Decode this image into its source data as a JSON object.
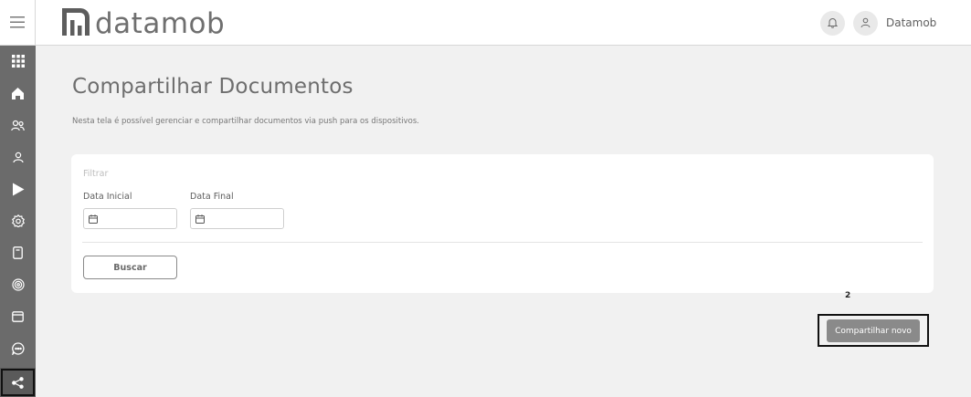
{
  "app": {
    "brand_prefix": "data",
    "brand_suffix": "mob",
    "user_name": "Datamob"
  },
  "sidebar": {
    "items": [
      {
        "name": "grid-icon"
      },
      {
        "name": "home-icon"
      },
      {
        "name": "users-icon"
      },
      {
        "name": "user-icon"
      },
      {
        "name": "play-store-icon"
      },
      {
        "name": "settings-icon"
      },
      {
        "name": "device-icon"
      },
      {
        "name": "fingerprint-icon"
      },
      {
        "name": "browser-icon"
      },
      {
        "name": "chat-icon"
      },
      {
        "name": "share-icon",
        "active": true
      }
    ]
  },
  "page": {
    "title": "Compartilhar Documentos",
    "description": "Nesta tela é possível gerenciar e compartilhar documentos via push para os dispositivos."
  },
  "filter": {
    "title": "Filtrar",
    "start_date_label": "Data Inicial",
    "end_date_label": "Data Final",
    "start_date_value": "",
    "end_date_value": "",
    "search_label": "Buscar"
  },
  "annotation": {
    "number": "2"
  },
  "actions": {
    "share_new_label": "Compartilhar novo"
  },
  "colors": {
    "sidebar": "#6b6b6b",
    "background": "#f1f1f1",
    "button": "#8a8a8a"
  }
}
